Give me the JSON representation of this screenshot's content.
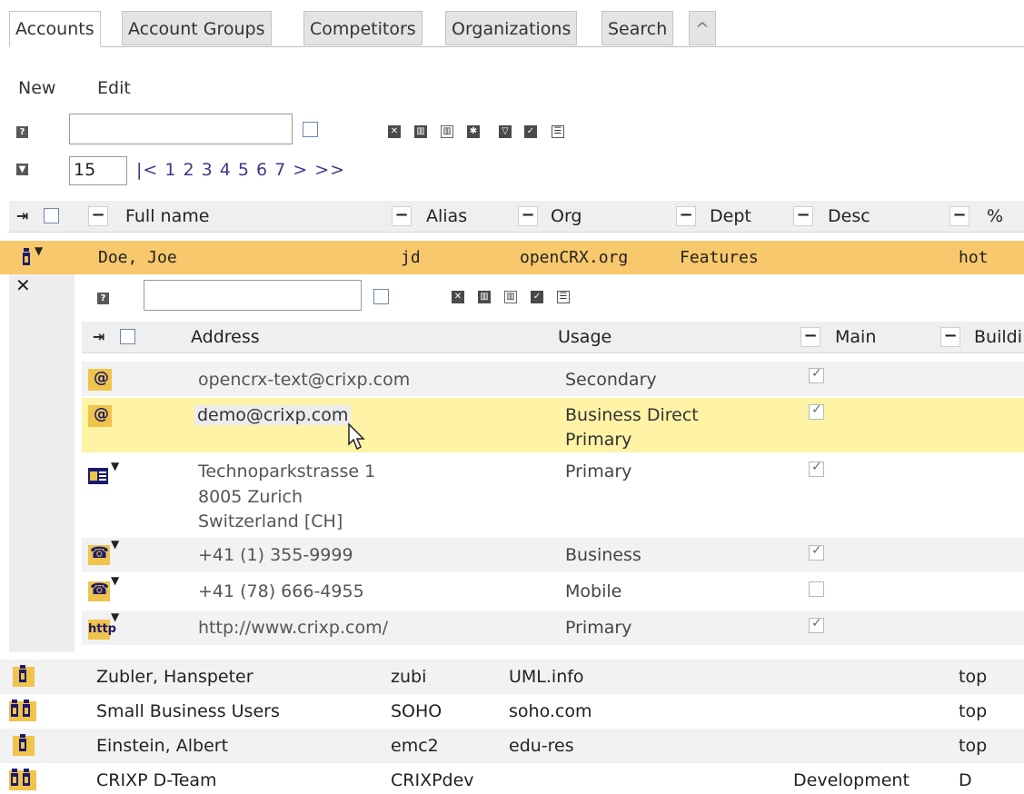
{
  "tabs": [
    {
      "label": "Accounts",
      "active": true
    },
    {
      "label": "Account Groups",
      "active": false
    },
    {
      "label": "Competitors",
      "active": false
    },
    {
      "label": "Organizations",
      "active": false
    },
    {
      "label": "Search",
      "active": false
    },
    {
      "label": "^",
      "active": false
    }
  ],
  "menu": {
    "new_label": "New",
    "edit_label": "Edit"
  },
  "filter": {
    "value": "",
    "help_icon": "question-icon"
  },
  "page_size": "15",
  "pager": {
    "first": "|<",
    "pages": "1 2 3 4 5 6 7",
    "next": ">",
    "last": ">>"
  },
  "columns": {
    "full_name": "Full name",
    "alias": "Alias",
    "org": "Org",
    "dept": "Dept",
    "desc": "Desc",
    "pct": "%",
    "minus": "−"
  },
  "selected_account": {
    "full_name": "Doe, Joe",
    "alias": "jd",
    "org": "openCRX.org",
    "dept": "Features",
    "desc": "",
    "pct": "hot"
  },
  "detail": {
    "close_label": "✕",
    "columns": {
      "address": "Address",
      "usage": "Usage",
      "main": "Main",
      "building": "Buildi"
    },
    "rows": [
      {
        "icon": "@",
        "address_lines": [
          "opencrx-text@crixp.com"
        ],
        "usage_lines": [
          "Secondary"
        ],
        "main": true
      },
      {
        "icon": "@",
        "address_lines": [
          "demo@crixp.com"
        ],
        "usage_lines": [
          "Business Direct",
          "Primary"
        ],
        "main": true
      },
      {
        "icon": "postal-icon",
        "address_lines": [
          "Technoparkstrasse 1",
          "8005 Zurich",
          "Switzerland [CH]"
        ],
        "usage_lines": [
          "Primary"
        ],
        "main": true
      },
      {
        "icon": "phone-icon",
        "address_lines": [
          "+41 (1) 355-9999"
        ],
        "usage_lines": [
          "Business"
        ],
        "main": true
      },
      {
        "icon": "phone-icon",
        "address_lines": [
          "+41 (78) 666-4955"
        ],
        "usage_lines": [
          "Mobile"
        ],
        "main": false
      },
      {
        "icon": "http",
        "address_lines": [
          "http://www.crixp.com/"
        ],
        "usage_lines": [
          "Primary"
        ],
        "main": true
      }
    ]
  },
  "accounts": [
    {
      "full_name": "Zubler, Hanspeter",
      "alias": "zubi",
      "org": "UML.info",
      "dept": "",
      "desc": "",
      "pct": "top",
      "type": "person"
    },
    {
      "full_name": "Small Business Users",
      "alias": "SOHO",
      "org": "soho.com",
      "dept": "",
      "desc": "",
      "pct": "top",
      "type": "group"
    },
    {
      "full_name": "Einstein, Albert",
      "alias": "emc2",
      "org": "edu-res",
      "dept": "",
      "desc": "",
      "pct": "top",
      "type": "person"
    },
    {
      "full_name": "CRIXP D-Team",
      "alias": "CRIXPdev",
      "org": "",
      "dept": "",
      "desc": "Development",
      "pct": "D",
      "type": "group"
    }
  ],
  "colors": {
    "selected_row": "#f8c86c",
    "hover_row": "#fff3a6",
    "header_bg": "#efefef",
    "icon_gold": "#f0c34a",
    "icon_navy": "#1a1a6e"
  }
}
